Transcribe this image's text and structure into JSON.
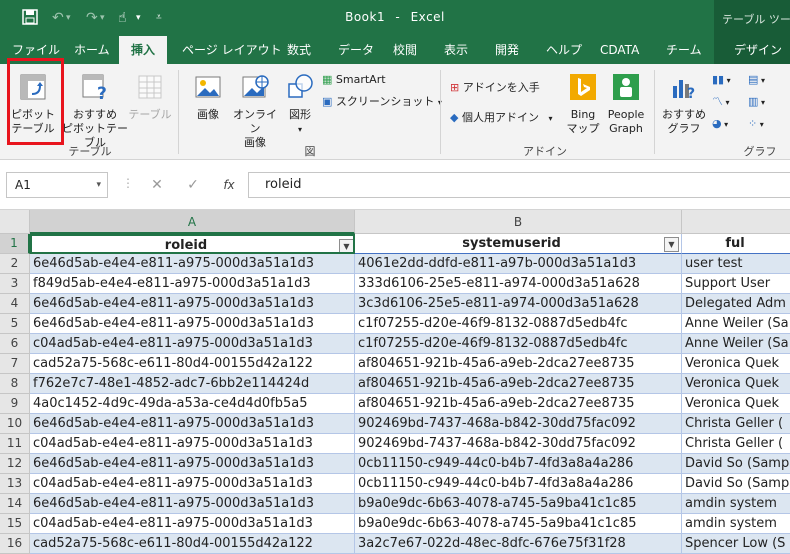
{
  "title": {
    "document": "Book1",
    "separator": "-",
    "app": "Excel",
    "context_tab": "テーブル ツール"
  },
  "tabs": [
    "ファイル",
    "ホーム",
    "挿入",
    "ページ レイアウト",
    "数式",
    "データ",
    "校閲",
    "表示",
    "開発",
    "ヘルプ",
    "CDATA",
    "チーム",
    "デザイン"
  ],
  "active_tab": "挿入",
  "ribbon": {
    "table_group": {
      "label": "テーブル",
      "pivot_line1": "ピボット",
      "pivot_line2": "テーブル",
      "rec_pivot_line1": "おすすめ",
      "rec_pivot_line2": "ピボットテーブル",
      "table": "テーブル"
    },
    "illustrations_group": {
      "label": "図",
      "image": "画像",
      "online_image_line1": "オンライン",
      "online_image_line2": "画像",
      "shapes": "図形",
      "smartart": "SmartArt",
      "screenshot": "スクリーンショット"
    },
    "addins_group": {
      "label": "アドイン",
      "get_addins": "アドインを入手",
      "my_addins": "個人用アドイン",
      "bing_line1": "Bing",
      "bing_line2": "マップ",
      "people_line1": "People",
      "people_line2": "Graph"
    },
    "charts_group": {
      "label": "グラフ",
      "rec_charts_line1": "おすすめ",
      "rec_charts_line2": "グラフ"
    }
  },
  "formula_bar": {
    "name_box": "A1",
    "cancel": "✕",
    "enter": "✓",
    "fx": "fx",
    "content": "roleid"
  },
  "sheet": {
    "columns": [
      "A",
      "B"
    ],
    "headers": [
      "roleid",
      "systemuserid",
      "ful"
    ],
    "rows": [
      {
        "n": "1"
      },
      {
        "n": "2",
        "a": "6e46d5ab-e4e4-e811-a975-000d3a51a1d3",
        "b": "4061e2dd-ddfd-e811-a97b-000d3a51a1d3",
        "c": "user test"
      },
      {
        "n": "3",
        "a": "f849d5ab-e4e4-e811-a975-000d3a51a1d3",
        "b": "333d6106-25e5-e811-a974-000d3a51a628",
        "c": "Support User"
      },
      {
        "n": "4",
        "a": "6e46d5ab-e4e4-e811-a975-000d3a51a1d3",
        "b": "3c3d6106-25e5-e811-a974-000d3a51a628",
        "c": "Delegated Adm"
      },
      {
        "n": "5",
        "a": "6e46d5ab-e4e4-e811-a975-000d3a51a1d3",
        "b": "c1f07255-d20e-46f9-8132-0887d5edb4fc",
        "c": "Anne Weiler (Sa"
      },
      {
        "n": "6",
        "a": "c04ad5ab-e4e4-e811-a975-000d3a51a1d3",
        "b": "c1f07255-d20e-46f9-8132-0887d5edb4fc",
        "c": "Anne Weiler (Sa"
      },
      {
        "n": "7",
        "a": "cad52a75-568c-e611-80d4-00155d42a122",
        "b": "af804651-921b-45a6-a9eb-2dca27ee8735",
        "c": "Veronica Quek"
      },
      {
        "n": "8",
        "a": "f762e7c7-48e1-4852-adc7-6bb2e114424d",
        "b": "af804651-921b-45a6-a9eb-2dca27ee8735",
        "c": "Veronica Quek"
      },
      {
        "n": "9",
        "a": "4a0c1452-4d9c-49da-a53a-ce4d4d0fb5a5",
        "b": "af804651-921b-45a6-a9eb-2dca27ee8735",
        "c": "Veronica Quek"
      },
      {
        "n": "10",
        "a": "6e46d5ab-e4e4-e811-a975-000d3a51a1d3",
        "b": "902469bd-7437-468a-b842-30dd75fac092",
        "c": "Christa Geller ("
      },
      {
        "n": "11",
        "a": "c04ad5ab-e4e4-e811-a975-000d3a51a1d3",
        "b": "902469bd-7437-468a-b842-30dd75fac092",
        "c": "Christa Geller ("
      },
      {
        "n": "12",
        "a": "6e46d5ab-e4e4-e811-a975-000d3a51a1d3",
        "b": "0cb11150-c949-44c0-b4b7-4fd3a8a4a286",
        "c": "David So (Samp"
      },
      {
        "n": "13",
        "a": "c04ad5ab-e4e4-e811-a975-000d3a51a1d3",
        "b": "0cb11150-c949-44c0-b4b7-4fd3a8a4a286",
        "c": "David So (Samp"
      },
      {
        "n": "14",
        "a": "6e46d5ab-e4e4-e811-a975-000d3a51a1d3",
        "b": "b9a0e9dc-6b63-4078-a745-5a9ba41c1c85",
        "c": "amdin system"
      },
      {
        "n": "15",
        "a": "c04ad5ab-e4e4-e811-a975-000d3a51a1d3",
        "b": "b9a0e9dc-6b63-4078-a745-5a9ba41c1c85",
        "c": "amdin system"
      },
      {
        "n": "16",
        "a": "cad52a75-568c-e611-80d4-00155d42a122",
        "b": "3a2c7e67-022d-48ec-8dfc-676e75f31f28",
        "c": "Spencer Low (S"
      }
    ]
  },
  "colors": {
    "excel_green": "#217346",
    "band_blue": "#dce6f1",
    "highlight_red": "#e8141d"
  },
  "icons": [
    "save-icon",
    "undo-icon",
    "redo-icon",
    "touch-mode-icon",
    "customize-qat-icon"
  ]
}
